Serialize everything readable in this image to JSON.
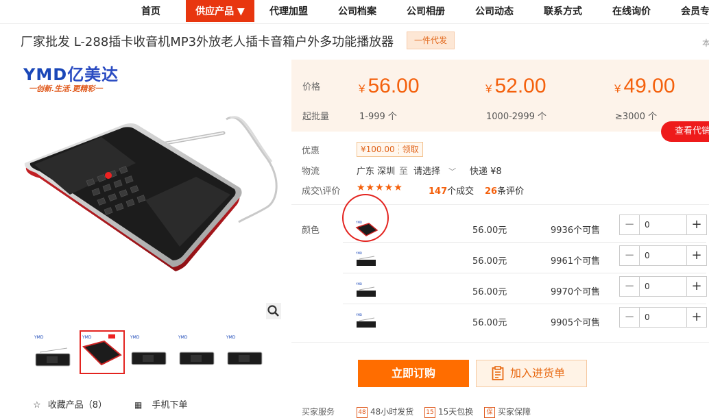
{
  "nav": {
    "items": [
      "首页",
      "供应产品 ▼",
      "代理加盟",
      "公司档案",
      "公司相册",
      "公司动态",
      "联系方式",
      "在线询价",
      "会员专"
    ],
    "active_index": 1
  },
  "product": {
    "title": "厂家批发 L-288插卡收音机MP3外放老人插卡音箱户外多功能播放器",
    "badge": "一件代发",
    "edge_char": "本"
  },
  "logo": {
    "latin": "YMD",
    "chinese": "亿美达",
    "slogan": "一创新.生活.更精彩一"
  },
  "gallery": {
    "thumb_count": 5,
    "selected_index": 1,
    "favorite_label": "收藏产品（8）",
    "mobile_label": "手机下单"
  },
  "pricing": {
    "price_label": "价格",
    "moq_label": "起批量",
    "currency": "¥",
    "tiers": [
      {
        "price": "56.00",
        "qty": "1-999 个"
      },
      {
        "price": "52.00",
        "qty": "1000-2999 个"
      },
      {
        "price": "49.00",
        "qty": "≥3000 个"
      }
    ],
    "agent_button": "查看代销"
  },
  "offer": {
    "label": "优惠",
    "coupon_value": "¥100.00",
    "coupon_action": "领取"
  },
  "logistics": {
    "label": "物流",
    "origin": "广东 深圳",
    "to": "至",
    "dest": "请选择",
    "shipping": "快递 ¥8"
  },
  "reviews": {
    "label": "成交\\评价",
    "stars": "★★★★★",
    "deals_count": "147",
    "deals_suffix": "个成交",
    "reviews_count": "26",
    "reviews_suffix": "条评价"
  },
  "variants": {
    "label": "颜色",
    "rows": [
      {
        "price": "56.00元",
        "stock": "9936个可售",
        "qty": "0"
      },
      {
        "price": "56.00元",
        "stock": "9961个可售",
        "qty": "0"
      },
      {
        "price": "56.00元",
        "stock": "9970个可售",
        "qty": "0"
      },
      {
        "price": "56.00元",
        "stock": "9905个可售",
        "qty": "0"
      }
    ]
  },
  "actions": {
    "order": "立即订购",
    "cart": "加入进货单"
  },
  "services": {
    "label": "买家服务",
    "items": [
      "48小时发货",
      "15天包换",
      "买家保障"
    ]
  },
  "colors": {
    "accent": "#f4600c",
    "nav_active": "#e8360f",
    "order_btn": "#ff6d00",
    "agent_btn": "#ee1b1b",
    "price_panel_bg": "#fdf3ea"
  }
}
